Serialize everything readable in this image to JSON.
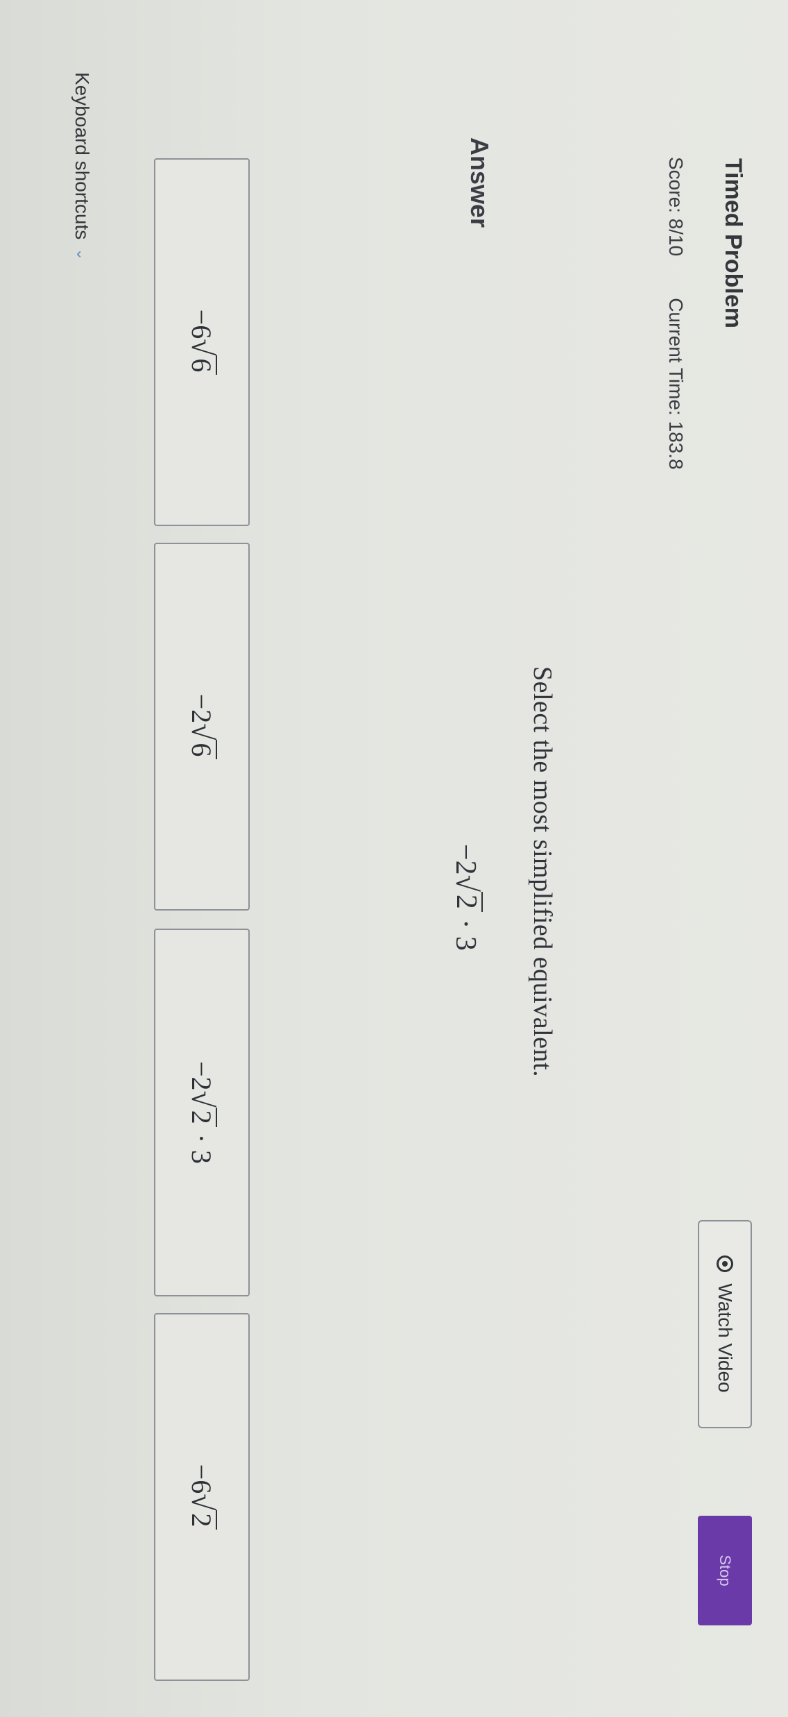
{
  "header": {
    "title": "Timed Problem",
    "score": "Score: 8/10",
    "current_time": "Current Time: 183.8",
    "watch_video_label": "Watch Video",
    "stop_label": "Stop"
  },
  "question": {
    "prompt": "Select the most simplified equivalent.",
    "expression": {
      "coefficient": "−2",
      "radicand": "2",
      "suffix": "· 3"
    }
  },
  "answer": {
    "label": "Answer",
    "choices": [
      {
        "coefficient": "−6",
        "radicand": "6",
        "suffix": ""
      },
      {
        "coefficient": "−2",
        "radicand": "6",
        "suffix": ""
      },
      {
        "coefficient": "−2",
        "radicand": "2",
        "suffix": "· 3"
      },
      {
        "coefficient": "−6",
        "radicand": "2",
        "suffix": ""
      }
    ]
  },
  "footer": {
    "keyboard_shortcuts_label": "Keyboard shortcuts",
    "chevron_icon": "chevron-down-icon"
  },
  "colors": {
    "stop_button": "#6a3aa8",
    "background": "#e3e5e0",
    "border": "#8e9298"
  }
}
